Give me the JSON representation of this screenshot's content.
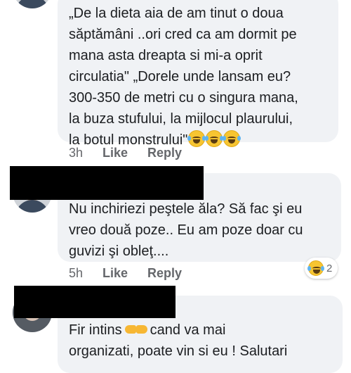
{
  "comments": [
    {
      "lines": [
        "„De la dieta aia de am tinut o doua",
        "săptămâni ..ori cred ca am dormit pe",
        "mana asta  dreapta si mi-a oprit",
        "circulatia\" „Dorele unde lansam eu?",
        "300-350 de metri cu o singura mana,",
        "la  buza stufului, la mijlocul plaurului,",
        "la botul monstrului\""
      ],
      "trailing_emoji": [
        "laugh-cry-icon",
        "laugh-cry-icon",
        "laugh-cry-icon"
      ],
      "time": "3h",
      "like_label": "Like",
      "reply_label": "Reply"
    },
    {
      "author_redacted": true,
      "lines": [
        "Nu inchiriezi peştele ăla? Să fac şi eu",
        "vreo două poze..  Eu am poze doar cu",
        "guvizi şi obleţ...."
      ],
      "time": "5h",
      "like_label": "Like",
      "reply_label": "Reply",
      "reaction": {
        "icon": "laugh-cry-icon",
        "count": "2"
      }
    },
    {
      "author_redacted": true,
      "line_before_emoji": "Fir intins",
      "emoji": "fist-bump-icon",
      "line_after_emoji": "cand va mai",
      "second_line": "organizati, poate vin si eu ! Salutari"
    }
  ],
  "colors": {
    "bubble": "#f0f2f5",
    "meta_text": "#65676b",
    "text": "#1c1e21",
    "redaction": "#000000"
  }
}
